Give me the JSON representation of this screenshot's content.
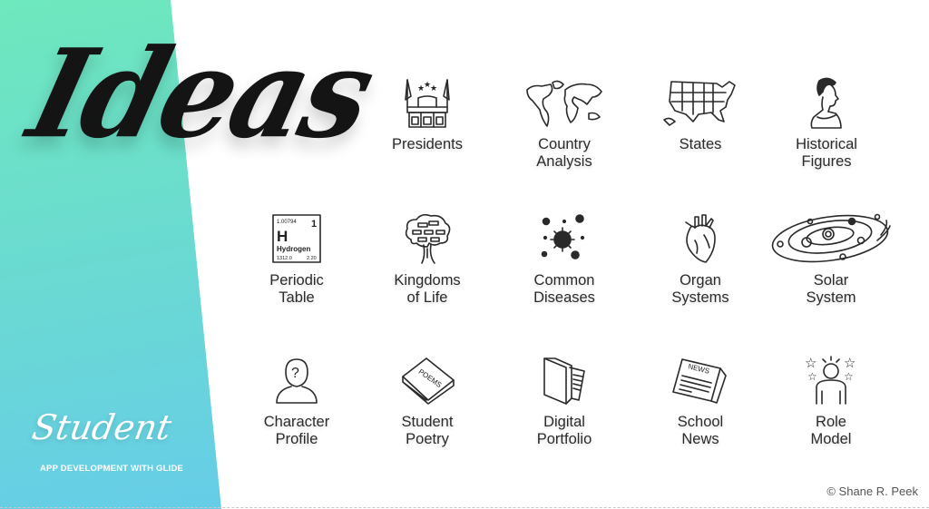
{
  "title": "Ideas",
  "brand": {
    "name": "Student",
    "subtitle": "APP DEVELOPMENT WITH GLIDE"
  },
  "credit": "© Shane R. Peek",
  "colors": {
    "gradient_top": "#6ee8bd",
    "gradient_bottom": "#64c6f2",
    "text": "#2b2b2b"
  },
  "ideas": [
    {
      "label": "Presidents",
      "icon": "capitol-building-icon"
    },
    {
      "label": "Country\nAnalysis",
      "icon": "world-map-icon"
    },
    {
      "label": "States",
      "icon": "us-map-icon"
    },
    {
      "label": "Historical\nFigures",
      "icon": "bust-portrait-icon"
    },
    {
      "label": "Periodic\nTable",
      "icon": "hydrogen-element-icon",
      "element": {
        "mass": "1.00794",
        "number": "1",
        "symbol": "H",
        "name": "Hydrogen",
        "ionization": "1312.0",
        "electronegativity": "2.20"
      }
    },
    {
      "label": "Kingdoms\nof Life",
      "icon": "tree-icon"
    },
    {
      "label": "Common\nDiseases",
      "icon": "virus-icon"
    },
    {
      "label": "Organ\nSystems",
      "icon": "heart-icon"
    },
    {
      "label": "Solar\nSystem",
      "icon": "solar-system-icon"
    },
    {
      "label": "Character\nProfile",
      "icon": "unknown-person-icon"
    },
    {
      "label": "Student\nPoetry",
      "icon": "poems-book-icon",
      "book_text": "POEMS"
    },
    {
      "label": "Digital\nPortfolio",
      "icon": "folder-icon"
    },
    {
      "label": "School\nNews",
      "icon": "newspaper-icon",
      "news_text": "NEWS"
    },
    {
      "label": "Role\nModel",
      "icon": "role-model-icon"
    }
  ]
}
